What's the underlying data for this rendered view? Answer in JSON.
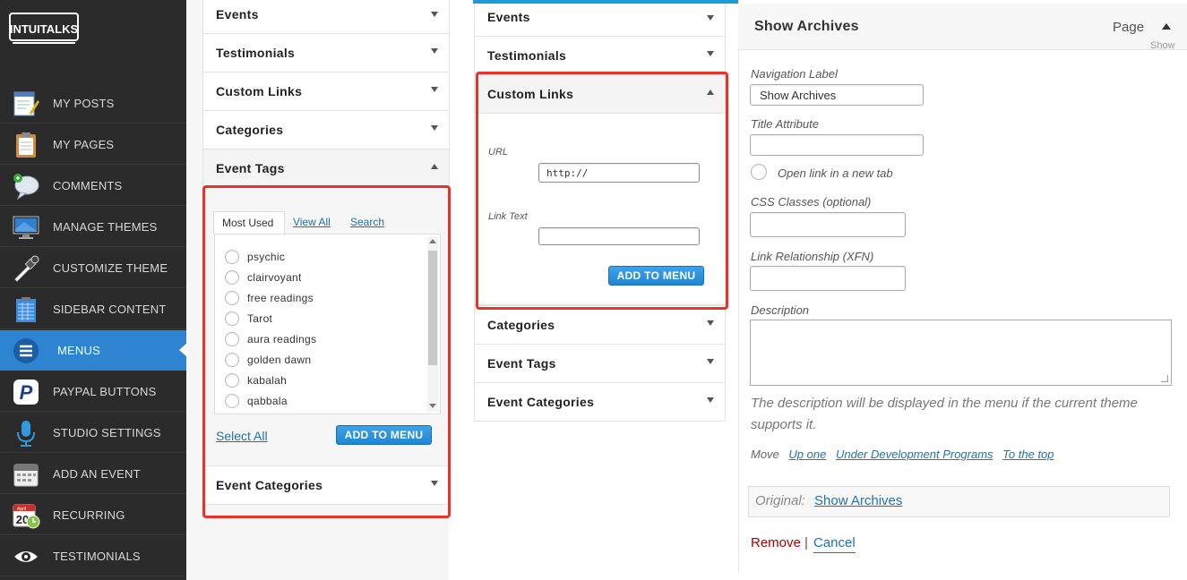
{
  "logo": {
    "text": "INTUITALKS"
  },
  "sidebar": {
    "items": [
      {
        "label": "MY POSTS",
        "icon": "notepad-pen-icon"
      },
      {
        "label": "MY PAGES",
        "icon": "clipboard-icon"
      },
      {
        "label": "COMMENTS",
        "icon": "speech-bubble-icon"
      },
      {
        "label": "MANAGE THEMES",
        "icon": "monitor-icon"
      },
      {
        "label": "CUSTOMIZE THEME",
        "icon": "eyedropper-icon"
      },
      {
        "label": "SIDEBAR CONTENT",
        "icon": "grid-sheet-icon"
      },
      {
        "label": "MENUS",
        "icon": "menu-lines-icon",
        "active": true
      },
      {
        "label": "PAYPAL BUTTONS",
        "icon": "paypal-icon"
      },
      {
        "label": "STUDIO SETTINGS",
        "icon": "microphone-icon"
      },
      {
        "label": "ADD AN EVENT",
        "icon": "calendar-icon"
      },
      {
        "label": "RECURRING",
        "icon": "calendar-clock-icon",
        "badge": "20",
        "badge_month": "April"
      },
      {
        "label": "TESTIMONIALS",
        "icon": "eye-icon"
      }
    ]
  },
  "panel1": {
    "rows": [
      "Events",
      "Testimonials",
      "Custom Links",
      "Categories",
      "Event Tags"
    ],
    "bottom_row": "Event Categories",
    "tabs": {
      "most_used": "Most Used",
      "view_all": "View All",
      "search": "Search"
    },
    "tags": [
      "psychic",
      "clairvoyant",
      "free readings",
      "Tarot",
      "aura readings",
      "golden dawn",
      "kabalah",
      "qabbala"
    ],
    "select_all": "Select All",
    "add_button": "ADD TO MENU"
  },
  "panel2": {
    "rows_top": [
      "Events",
      "Testimonials"
    ],
    "open_row": "Custom Links",
    "url_label": "URL",
    "url_value": "http://",
    "link_text_label": "Link Text",
    "link_text_value": "",
    "add_button": "ADD TO MENU",
    "rows_bottom": [
      "Categories",
      "Event Tags",
      "Event Categories"
    ]
  },
  "panel3": {
    "title": "Show Archives",
    "page_label": "Page",
    "show_partial": "Show",
    "nav_label": "Navigation Label",
    "nav_value": "Show Archives",
    "title_attr_label": "Title Attribute",
    "title_attr_value": "",
    "new_tab_label": "Open link in a new tab",
    "css_label": "CSS Classes (optional)",
    "css_value": "",
    "xfn_label": "Link Relationship (XFN)",
    "xfn_value": "",
    "desc_label": "Description",
    "desc_help": "The description will be displayed in the menu if the current theme supports it.",
    "move_label": "Move",
    "move_links": [
      "Up one",
      "Under Development Programs",
      "To the top"
    ],
    "original_label": "Original:",
    "original_link": "Show Archives",
    "remove": "Remove",
    "separator": "|",
    "cancel": "Cancel"
  },
  "colors": {
    "sidebar_bg": "#2b2b2b",
    "active_blue": "#2e84d0",
    "highlight_red": "#e8322a",
    "link_blue": "#2271b1",
    "remove_red": "#aa0000"
  }
}
